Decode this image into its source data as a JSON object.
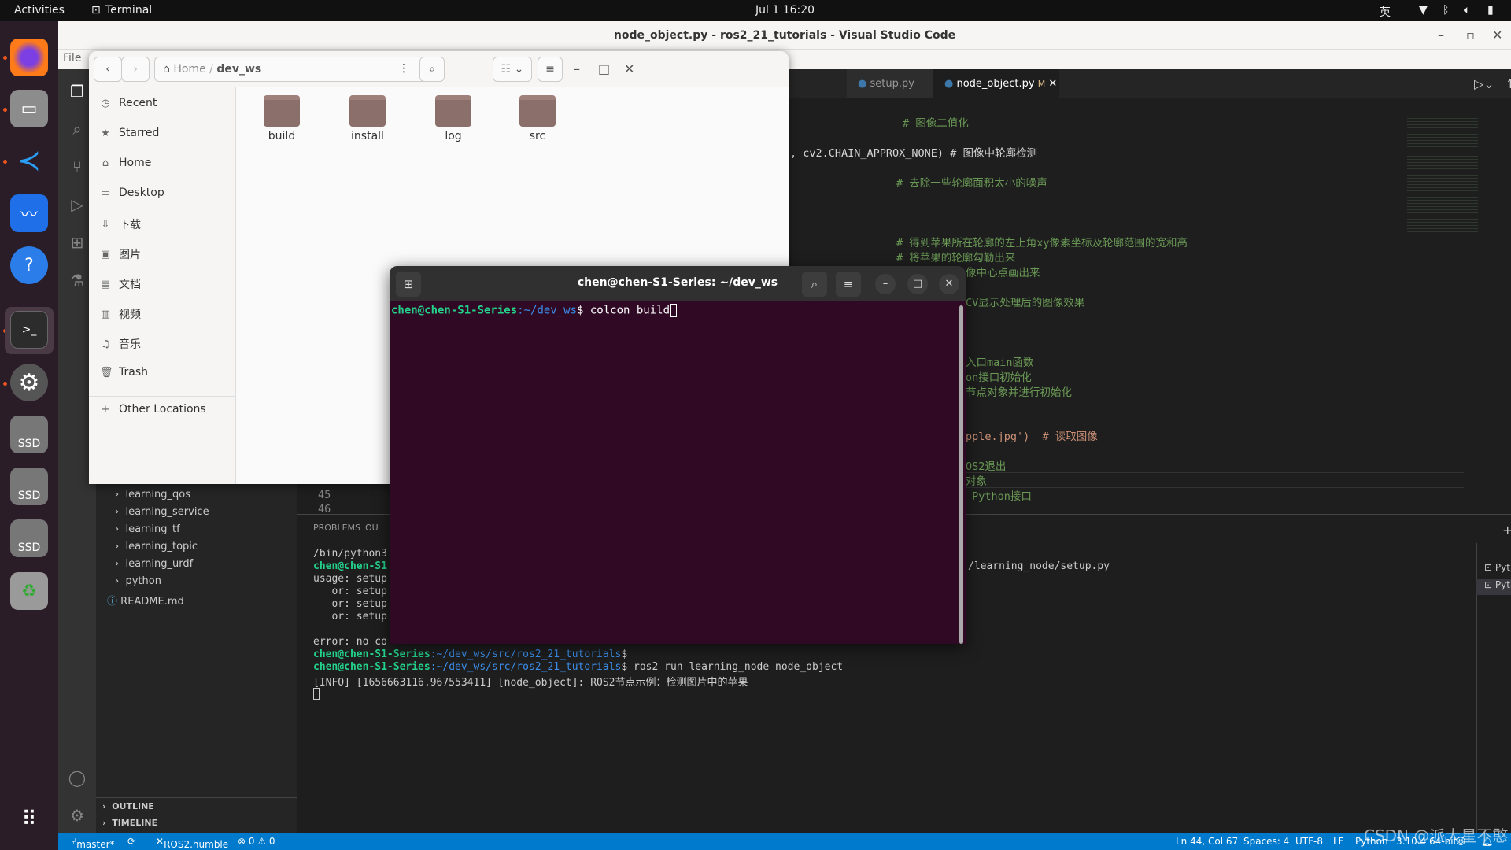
{
  "topbar": {
    "activities": "Activities",
    "app": "Terminal",
    "clock": "Jul 1  16:20",
    "ime": "英"
  },
  "dock": {
    "items": [
      "firefox",
      "files",
      "vscode",
      "feishu",
      "help",
      "terminal",
      "settings",
      "ssd-1",
      "ssd-2",
      "ssd-3",
      "trash",
      "apps"
    ],
    "ssd_label": "SSD"
  },
  "vscode": {
    "title": "node_object.py - ros2_21_tutorials - Visual Studio Code",
    "menu_file": "File",
    "tabs": [
      {
        "label": "setup.py"
      },
      {
        "label": "node_object.py",
        "badge": "M"
      }
    ],
    "explorer": {
      "items": [
        "learning_qos",
        "learning_service",
        "learning_tf",
        "learning_topic",
        "learning_urdf",
        "python",
        "README.md"
      ],
      "outline": "OUTLINE",
      "timeline": "TIMELINE"
    },
    "editor": {
      "line_numbers": [
        "45",
        "46"
      ],
      "lines": [
        "# 图像二值化",
        ", cv2.CHAIN_APPROX_NONE) # 图像中轮廓检测",
        "# 去除一些轮廓面积太小的噪声",
        "# 得到苹果所在轮廓的左上角xy像素坐标及轮廓范围的宽和高",
        "# 将苹果的轮廓勾勒出来",
        "像中心点画出来",
        "CV显示处理后的图像效果",
        "入口main函数",
        "on接口初始化",
        "节点对象并进行初始化",
        "pple.jpg')  # 读取图像",
        "OS2退出",
        "对象",
        " Python接口"
      ]
    },
    "panel": {
      "tabs": [
        "PROBLEMS",
        "OU"
      ],
      "lines": [
        "/bin/python3",
        "chen@chen-S1",
        "usage: setup",
        "   or: setup",
        "   or: setup",
        "   or: setup",
        "",
        "error: no co"
      ],
      "line2_tail": "/learning_node/setup.py",
      "prompt_user": "chen@chen-S1-Series",
      "prompt_path": ":~/dev_ws/src/ros2_21_tutorials",
      "cmd": "$ ros2 run learning_node node_object",
      "prompt_end": "$",
      "info": "[INFO] [1656663116.967553411] [node_object]: ROS2节点示例：检测图片中的苹果",
      "terminals": [
        "Python",
        "Python"
      ]
    },
    "status": {
      "branch": "master*",
      "ros": "ROS2.humble",
      "problems": "⊗ 0 ⚠ 0",
      "position": "Ln 44, Col 67",
      "spaces": "Spaces: 4",
      "encoding": "UTF-8",
      "eol": "LF",
      "language": "Python",
      "interpreter": "3.10.4 64-bit"
    },
    "watermark": "CSDN @派大星不憨"
  },
  "files": {
    "breadcrumb": {
      "home": "Home",
      "current": "dev_ws"
    },
    "sidebar": [
      "Recent",
      "Starred",
      "Home",
      "Desktop",
      "下载",
      "图片",
      "文档",
      "视频",
      "音乐",
      "Trash"
    ],
    "other_locations": "Other Locations",
    "folders": [
      "build",
      "install",
      "log",
      "src"
    ]
  },
  "terminal": {
    "title": "chen@chen-S1-Series: ~/dev_ws",
    "prompt_user": "chen@chen-S1-Series",
    "prompt_path": ":~/dev_ws",
    "prompt_end": "$ ",
    "command": "colcon build"
  },
  "colors": {
    "accent": "#007acc",
    "terminal_bg": "#300a24",
    "comment": "#6a9955",
    "prompt_green": "#23d18b"
  }
}
